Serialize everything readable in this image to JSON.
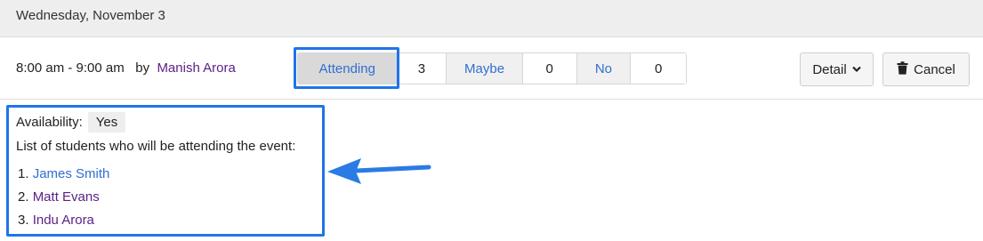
{
  "header": {
    "date": "Wednesday, November 3"
  },
  "event": {
    "time": "8:00 am - 9:00 am",
    "by_label": "by",
    "organizer": "Manish Arora"
  },
  "rsvp": {
    "attending_label": "Attending",
    "attending_count": "3",
    "maybe_label": "Maybe",
    "maybe_count": "0",
    "no_label": "No",
    "no_count": "0",
    "selected": "Attending"
  },
  "actions": {
    "detail_label": "Detail",
    "cancel_label": "Cancel"
  },
  "availability": {
    "label": "Availability:",
    "value": "Yes",
    "list_description": "List of students who will be attending the event:",
    "students": [
      {
        "num": "1.",
        "name": "James Smith"
      },
      {
        "num": "2.",
        "name": "Matt Evans"
      },
      {
        "num": "3.",
        "name": "Indu Arora"
      }
    ]
  },
  "icons": {
    "detail_caret": "chevron-down-icon",
    "cancel": "trash-icon",
    "annotation": "arrow-left-icon"
  },
  "colors": {
    "highlight": "#1f74ea",
    "link_blue": "#2f6fd1",
    "link_purple": "#5b1f85",
    "header_bg": "#eeeeee"
  }
}
